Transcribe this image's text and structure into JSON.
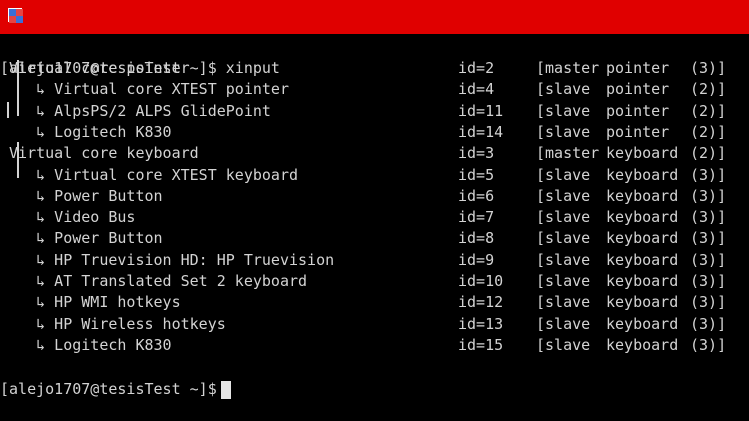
{
  "window": {
    "title": ""
  },
  "terminal": {
    "prompt_top": "[alejo1707@tesisTest ~]$ xinput",
    "rows": [
      {
        "name": " Virtual core pointer",
        "id": "id=2",
        "role": "[master",
        "type": "pointer",
        "num": "(3)]"
      },
      {
        "name": "    ↳ Virtual core XTEST pointer",
        "id": "id=4",
        "role": "[slave",
        "type": "pointer",
        "num": "(2)]"
      },
      {
        "name": "    ↳ AlpsPS/2 ALPS GlidePoint",
        "id": "id=11",
        "role": "[slave",
        "type": "pointer",
        "num": "(2)]"
      },
      {
        "name": "    ↳ Logitech K830",
        "id": "id=14",
        "role": "[slave",
        "type": "pointer",
        "num": "(2)]"
      },
      {
        "name": " Virtual core keyboard",
        "id": "id=3",
        "role": "[master",
        "type": "keyboard",
        "num": "(2)]"
      },
      {
        "name": "    ↳ Virtual core XTEST keyboard",
        "id": "id=5",
        "role": "[slave",
        "type": "keyboard",
        "num": "(3)]"
      },
      {
        "name": "    ↳ Power Button",
        "id": "id=6",
        "role": "[slave",
        "type": "keyboard",
        "num": "(3)]"
      },
      {
        "name": "    ↳ Video Bus",
        "id": "id=7",
        "role": "[slave",
        "type": "keyboard",
        "num": "(3)]"
      },
      {
        "name": "    ↳ Power Button",
        "id": "id=8",
        "role": "[slave",
        "type": "keyboard",
        "num": "(3)]"
      },
      {
        "name": "    ↳ HP Truevision HD: HP Truevision",
        "id": "id=9",
        "role": "[slave",
        "type": "keyboard",
        "num": "(3)]"
      },
      {
        "name": "    ↳ AT Translated Set 2 keyboard",
        "id": "id=10",
        "role": "[slave",
        "type": "keyboard",
        "num": "(3)]"
      },
      {
        "name": "    ↳ HP WMI hotkeys",
        "id": "id=12",
        "role": "[slave",
        "type": "keyboard",
        "num": "(3)]"
      },
      {
        "name": "    ↳ HP Wireless hotkeys",
        "id": "id=13",
        "role": "[slave",
        "type": "keyboard",
        "num": "(3)]"
      },
      {
        "name": "    ↳ Logitech K830",
        "id": "id=15",
        "role": "[slave",
        "type": "keyboard",
        "num": "(3)]"
      }
    ],
    "prompt_bottom": "[alejo1707@tesisTest ~]$"
  },
  "colors": {
    "titlebar": "#e00000",
    "background": "#000000",
    "text": "#d3d3d3"
  },
  "icons": {
    "app": "terminal-app-icon"
  }
}
